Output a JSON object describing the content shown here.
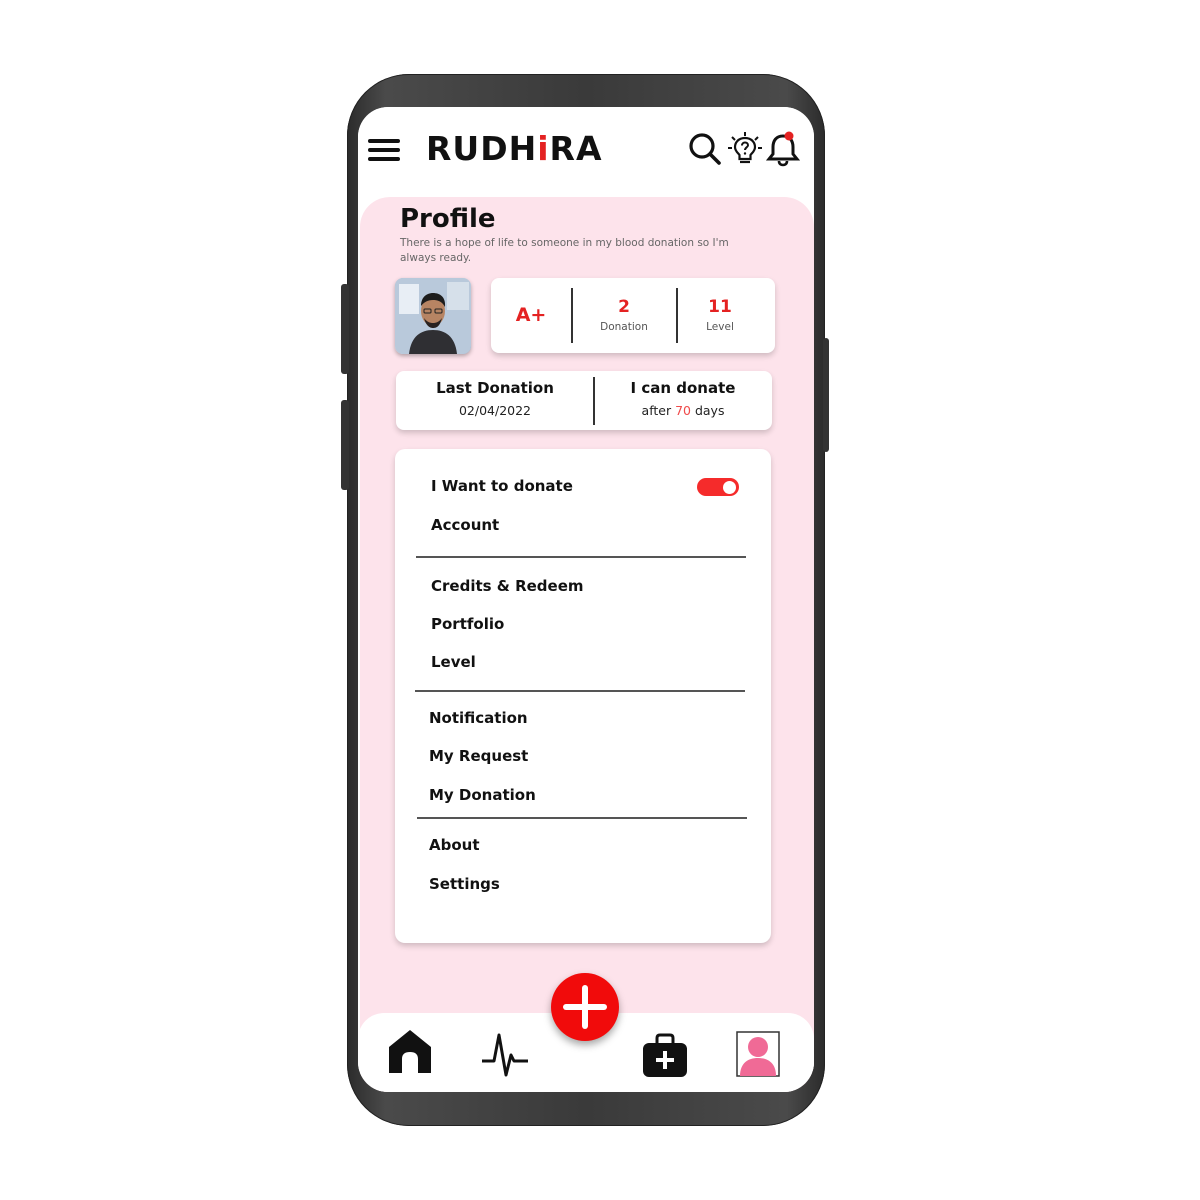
{
  "app": {
    "logo_prefix": "RUDH",
    "logo_i": "i",
    "logo_suffix": "RA"
  },
  "header": {
    "icons": [
      "menu-icon",
      "search-icon",
      "idea-help-icon",
      "notification-bell-icon"
    ],
    "has_unread_notification": true
  },
  "profile": {
    "title": "Profile",
    "subtitle": "There is a hope of life to someone in my blood donation so I'm always ready."
  },
  "stats": {
    "blood_group": "A+",
    "donation_count": "2",
    "donation_label": "Donation",
    "level_value": "11",
    "level_label": "Level"
  },
  "donation_info": {
    "last_label": "Last Donation",
    "last_date": "02/04/2022",
    "can_label": "I can donate",
    "after_prefix": "after ",
    "after_days": "70",
    "after_suffix": " days"
  },
  "menu": {
    "want_to_donate": "I Want to donate",
    "want_to_donate_on": true,
    "account": "Account",
    "credits": "Credits & Redeem",
    "portfolio": "Portfolio",
    "level": "Level",
    "notification": "Notification",
    "my_request": "My Request",
    "my_donation": "My Donation",
    "about": "About",
    "settings": "Settings"
  },
  "bottom_nav": {
    "items": [
      "home-icon",
      "activity-pulse-icon",
      "add-button",
      "medical-kit-icon",
      "profile-icon"
    ]
  },
  "colors": {
    "accent": "#e42222",
    "panel": "#fde3eb",
    "toggle": "#f52b2b",
    "fab": "#f10b0b",
    "profile_icon": "#f06a96"
  }
}
